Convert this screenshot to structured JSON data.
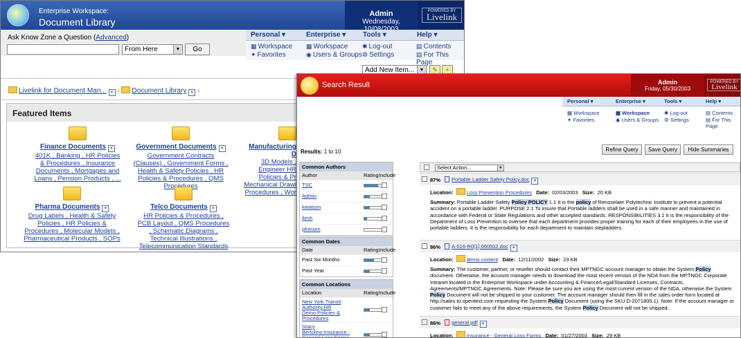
{
  "back_window": {
    "header": {
      "subtitle": "Enterprise Workspace:",
      "title": "Document Library",
      "user": "Admin",
      "date": "Wednesday, 10/08/2003",
      "logo_small": "POWERED BY",
      "logo_big": "Livelink"
    },
    "ask": {
      "label": "Ask Know Zone a Question (",
      "label_link": "Advanced",
      "label_end": ")",
      "input_value": "",
      "scope": "From Here",
      "go": "Go"
    },
    "menus": [
      {
        "label": "Personal ▾",
        "items": [
          "Workspace",
          "Favorites"
        ]
      },
      {
        "label": "Enterprise ▾",
        "items": [
          "Workspace",
          "Users & Groups"
        ]
      },
      {
        "label": "Tools ▾",
        "items": [
          "Log-out",
          "Settings"
        ]
      },
      {
        "label": "Help ▾",
        "items": [
          "Contents",
          "For This Page"
        ]
      }
    ],
    "add_item": "Add New Item...",
    "breadcrumb": [
      "Livelink for Document Man...",
      "Document Library"
    ],
    "featured_title": "Featured Items",
    "categories": [
      {
        "name": "Finance Documents",
        "links": "401K ,  Banking ,  HR Policies & Procedures ,  Insurance Documents , Mortgages and Loans ,  Pension Products ,  ..."
      },
      {
        "name": "Government Documents",
        "links": "Government Contracts (Clauses) , Government Forms ,  Health & Safety Policies ,  HR Policies & Procedures , QMS Procedures"
      },
      {
        "name": "Manufacturing D",
        "links": "3D Models ,  Engineer HR Policies & Pr Mechanical Drawi Procedures ,  Wor"
      },
      {
        "name": "Pharma Documents",
        "links": "Drug Labels ,  Health & Safety Policies ,  HR Policies & Procedures , Molecular Models ,  Pharmaceutical Products ,  SOPs"
      },
      {
        "name": "Telco Documents",
        "links": "HR Policies & Procedures ,  PCB Layout ,  QMS Procedures , Schematic Diagrams ,  Technical Illustrations ,  Telecommunication Standards"
      }
    ]
  },
  "front_window": {
    "header": {
      "title": "Search Result",
      "user": "Admin",
      "date": "Friday, 05/30/2003",
      "logo_small": "POWERED BY",
      "logo_big": "Livelink"
    },
    "menus": [
      {
        "label": "Personal ▾",
        "items": [
          "Workspace",
          "Favorites"
        ]
      },
      {
        "label": "Enterprise ▾",
        "items": [
          "Workspace",
          "Users & Groups"
        ]
      },
      {
        "label": "Tools ▾",
        "items": [
          "Log-out",
          "Settings"
        ]
      },
      {
        "label": "Help ▾",
        "items": [
          "Contents",
          "For This Page"
        ]
      }
    ],
    "results_label": "Results:",
    "results_range": "1 to 10",
    "buttons": [
      "Refine Query",
      "Save Query",
      "Hide Summaries"
    ],
    "select_action": "Select Action...",
    "authors": {
      "title": "Common Authors",
      "cols": [
        "Author",
        "Rating",
        "Include"
      ],
      "rows": [
        {
          "name": "TSC",
          "rating": 0.7
        },
        {
          "name": "Admin",
          "rating": 0.3
        },
        {
          "name": "kwatson",
          "rating": 0.3
        },
        {
          "name": "jlesh",
          "rating": 0.15
        },
        {
          "name": "pfriesen",
          "rating": 0.0
        }
      ]
    },
    "dates": {
      "title": "Common Dates",
      "cols": [
        "Date",
        "Rating",
        "Include"
      ],
      "rows": [
        {
          "name": "Past Six Months",
          "rating": 0.5
        },
        {
          "name": "Past Year",
          "rating": 0.3
        }
      ]
    },
    "locations": {
      "title": "Common Locations",
      "cols": [
        "Location",
        "Rating",
        "Include"
      ],
      "rows": [
        {
          "name": "New York Transit Authority:HR Demo:Policies & Procedures",
          "rating": 0.3
        },
        {
          "name": "Stacy Bertolino:Insurance - General Loss Forms",
          "rating": 0.3
        }
      ]
    },
    "results": [
      {
        "pct": "87%",
        "name": "Portable Ladder Safety Policy.doc",
        "location": "Loss Prevention Procedures",
        "date": "02/03/2003",
        "size": "20 KB",
        "summary": [
          [
            "Portable Ladder Safety ",
            0
          ],
          [
            "Policy POLICY",
            1
          ],
          [
            " 1.1 It is the ",
            0
          ],
          [
            "policy",
            1
          ],
          [
            " of Rensselaer Polytechnic Institute to prevent a potential accident on a portable ladder. PURPOSE 2.1 To insure that Portable ladders shall be used in a safe manner and maintained in accordance with Federal or State Regulations and other accepted standards. RESPONSIBILITIES 3.1 It is the responsibility of the Department of Loss Prevention to oversee that each department provides proper training for each of their employees in the use of portable ladders. It is the responsibility for each department to maintain stepladders.",
            0
          ]
        ]
      },
      {
        "pct": "86%",
        "name": "A-016-R0[1].060502.doc",
        "location": "demo content",
        "date": "12/11/2002",
        "size": "23 KB",
        "summary": [
          [
            "The customer, partner, or reseller should contact their MPTNGC account manager to obtain the System ",
            0
          ],
          [
            "Policy",
            1
          ],
          [
            " document. Otherwise, the account manager needs to download the most recent version of the NDA from the MPTNGC Corporate Intranet located in the Enterprise Workspace under Accounting & Finance/Legal/Standard Licenses, Contracts, Agreements/MPTNGC Agreements. Note: Please be sure you are using the most current version of the NDA, otherwise the System ",
            0
          ],
          [
            "Policy",
            1
          ],
          [
            " Document will not be shipped to your customer. The account manager should then fill in the sales order form located at http://sales.to.opentext.com requesting the System ",
            0
          ],
          [
            "Policy",
            1
          ],
          [
            " Document (using the SKU D-2071800.1). Note: If the account manager or customer fails to meet any of the above requirements, the System ",
            0
          ],
          [
            "Policy",
            1
          ],
          [
            " Document will not be shipped.",
            0
          ]
        ]
      },
      {
        "pct": "86%",
        "name": "general.pdf",
        "location": "Insurance - General Loss Forms",
        "date": "01/27/2003",
        "size": "29 KB",
        "summary": []
      }
    ],
    "labels": {
      "location": "Location:",
      "date": "Date:",
      "size": "Size:",
      "summary": "Summary:"
    }
  }
}
